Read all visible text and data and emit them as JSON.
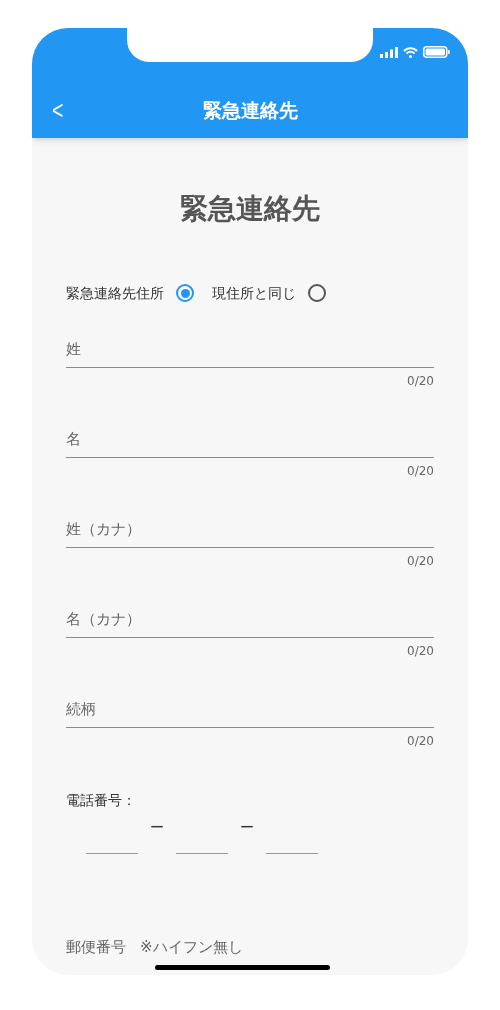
{
  "app_bar": {
    "back": "<",
    "title": "緊急連絡先"
  },
  "heading": "緊急連絡先",
  "address_options": [
    {
      "label": "緊急連絡先住所",
      "selected": true
    },
    {
      "label": "現住所と同じ",
      "selected": false
    }
  ],
  "fields": [
    {
      "placeholder": "姓",
      "counter": "0/20"
    },
    {
      "placeholder": "名",
      "counter": "0/20"
    },
    {
      "placeholder": "姓（カナ）",
      "counter": "0/20"
    },
    {
      "placeholder": "名（カナ）",
      "counter": "0/20"
    },
    {
      "placeholder": "続柄",
      "counter": "0/20"
    }
  ],
  "phone": {
    "label": "電話番号：",
    "separators": [
      "ー",
      "ー"
    ]
  },
  "postal": {
    "label": "郵便番号",
    "note": "※ハイフン無し"
  }
}
